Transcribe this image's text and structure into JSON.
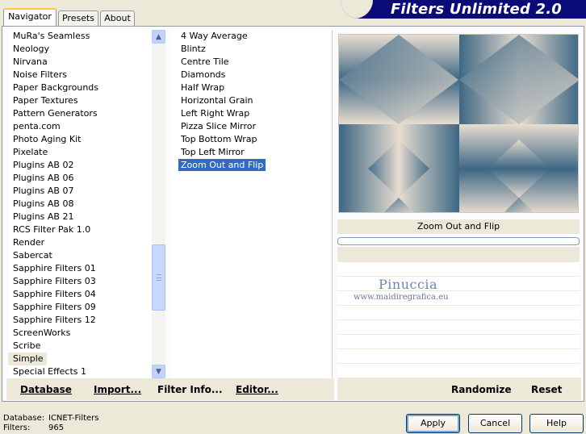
{
  "tabs": [
    {
      "label": "Navigator",
      "active": true
    },
    {
      "label": "Presets",
      "active": false
    },
    {
      "label": "About",
      "active": false
    }
  ],
  "banner": {
    "title": "Filters Unlimited 2.0"
  },
  "categories": [
    "MuRa's Seamless",
    "Neology",
    "Nirvana",
    "Noise Filters",
    "Paper Backgrounds",
    "Paper Textures",
    "Pattern Generators",
    "penta.com",
    "Photo Aging Kit",
    "Pixelate",
    "Plugins AB 02",
    "Plugins AB 06",
    "Plugins AB 07",
    "Plugins AB 08",
    "Plugins AB 21",
    "RCS Filter Pak 1.0",
    "Render",
    "Sabercat",
    "Sapphire Filters 01",
    "Sapphire Filters 03",
    "Sapphire Filters 04",
    "Sapphire Filters 09",
    "Sapphire Filters 12",
    "ScreenWorks",
    "Scribe",
    "Simple",
    "Special Effects 1"
  ],
  "selected_category": "Simple",
  "filters": [
    "4 Way Average",
    "Blintz",
    "Centre Tile",
    "Diamonds",
    "Half Wrap",
    "Horizontal Grain",
    "Left Right Wrap",
    "Pizza Slice Mirror",
    "Top Bottom Wrap",
    "Top Left Mirror",
    "Zoom Out and Flip"
  ],
  "selected_filter": "Zoom Out and Flip",
  "preview": {
    "name": "Zoom Out and Flip",
    "colors": {
      "dark": "#3d6784",
      "light": "#e8ddd0"
    }
  },
  "watermark": {
    "name": "Pinuccia",
    "url": "www.maidiregrafica.eu"
  },
  "bottom_left": {
    "database": "Database",
    "import": "Import...",
    "filter_info": "Filter Info...",
    "editor": "Editor..."
  },
  "bottom_right": {
    "randomize": "Randomize",
    "reset": "Reset"
  },
  "footer": {
    "database_label": "Database:",
    "database_value": "ICNET-Filters",
    "filters_label": "Filters:",
    "filters_value": "965"
  },
  "buttons": {
    "apply": "Apply",
    "cancel": "Cancel",
    "help": "Help"
  }
}
